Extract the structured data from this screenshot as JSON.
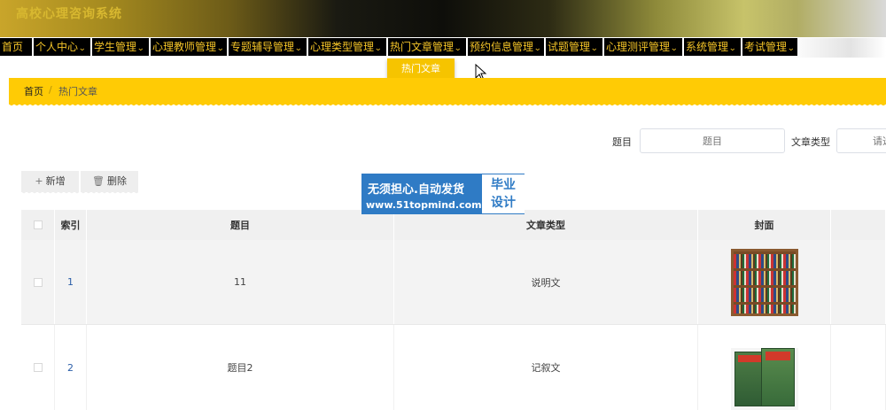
{
  "app": {
    "title": "高校心理咨询系统"
  },
  "nav": {
    "items": [
      {
        "label": "首页",
        "has_dropdown": false
      },
      {
        "label": "个人中心",
        "has_dropdown": true
      },
      {
        "label": "学生管理",
        "has_dropdown": true
      },
      {
        "label": "心理教师管理",
        "has_dropdown": true
      },
      {
        "label": "专题辅导管理",
        "has_dropdown": true
      },
      {
        "label": "心理类型管理",
        "has_dropdown": true
      },
      {
        "label": "热门文章管理",
        "has_dropdown": true,
        "active": true
      },
      {
        "label": "预约信息管理",
        "has_dropdown": true
      },
      {
        "label": "试题管理",
        "has_dropdown": true
      },
      {
        "label": "心理测评管理",
        "has_dropdown": true
      },
      {
        "label": "系统管理",
        "has_dropdown": true
      },
      {
        "label": "考试管理",
        "has_dropdown": true
      }
    ],
    "dropdown": {
      "items": [
        "热门文章"
      ]
    }
  },
  "breadcrumb": {
    "home": "首页",
    "separator": "/",
    "current": "热门文章"
  },
  "search": {
    "title_label": "题目",
    "title_placeholder": "题目",
    "type_label": "文章类型",
    "type_placeholder": "请选"
  },
  "actions": {
    "add_label": "新增",
    "delete_label": "删除"
  },
  "watermark": {
    "line1": "无须担心.自动发货",
    "line2": "www.51topmind.com",
    "badge_top": "毕业",
    "badge_bottom": "设计"
  },
  "table": {
    "columns": [
      "",
      "索引",
      "题目",
      "文章类型",
      "封面",
      ""
    ],
    "rows": [
      {
        "index": "1",
        "title": "11",
        "type": "说明文",
        "cover": "bookshelf"
      },
      {
        "index": "2",
        "title": "题目2",
        "type": "记叙文",
        "cover": "comic-books"
      }
    ]
  },
  "colors": {
    "accent": "#ffcb05",
    "nav_bg": "#000000",
    "nav_text": "#f4c428",
    "watermark": "#2f7bc5"
  }
}
